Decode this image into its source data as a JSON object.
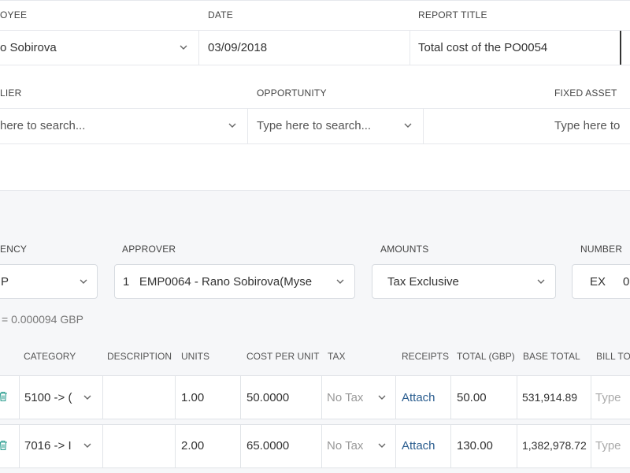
{
  "top_row": {
    "employee_label": "OYEE",
    "employee_value": "o Sobirova",
    "date_label": "DATE",
    "date_value": "03/09/2018",
    "report_title_label": "REPORT TITLE",
    "report_title_value": "Total cost of the PO0054"
  },
  "second_row": {
    "supplier_label": "LIER",
    "supplier_placeholder": "here to search...",
    "opportunity_label": "OPPORTUNITY",
    "opportunity_placeholder": "Type here to search...",
    "fixed_asset_label": "FIXED ASSET",
    "fixed_asset_placeholder": "Type here to"
  },
  "settings": {
    "currency_label": "ENCY",
    "currency_value": "P",
    "approver_label": "APPROVER",
    "approver_value": "1   EMP0064 - Rano Sobirova(Myse",
    "amounts_label": "AMOUNTS",
    "amounts_value": "Tax Exclusive",
    "number_label": "NUMBER",
    "number_prefix": "EX",
    "number_value": "0",
    "rate_note": "= 0.000094 GBP"
  },
  "table": {
    "headers": {
      "category": "CATEGORY",
      "description": "DESCRIPTION",
      "units": "UNITS",
      "cost_per_unit": "COST PER UNIT",
      "tax": "TAX",
      "receipts": "RECEIPTS",
      "total": "TOTAL (GBP)",
      "base_total": "BASE TOTAL",
      "bill_to": "BILL TO"
    },
    "rows": [
      {
        "category": "5100 -> (",
        "description": "",
        "units": "1.00",
        "cost_per_unit": "50.0000",
        "tax": "No Tax",
        "receipts": "Attach",
        "total": "50.00",
        "base_total": "531,914.89",
        "bill_to_placeholder": "Type"
      },
      {
        "category": "7016 -> I",
        "description": "",
        "units": "2.00",
        "cost_per_unit": "65.0000",
        "tax": "No Tax",
        "receipts": "Attach",
        "total": "130.00",
        "base_total": "1,382,978.72",
        "bill_to_placeholder": "Type"
      }
    ]
  }
}
